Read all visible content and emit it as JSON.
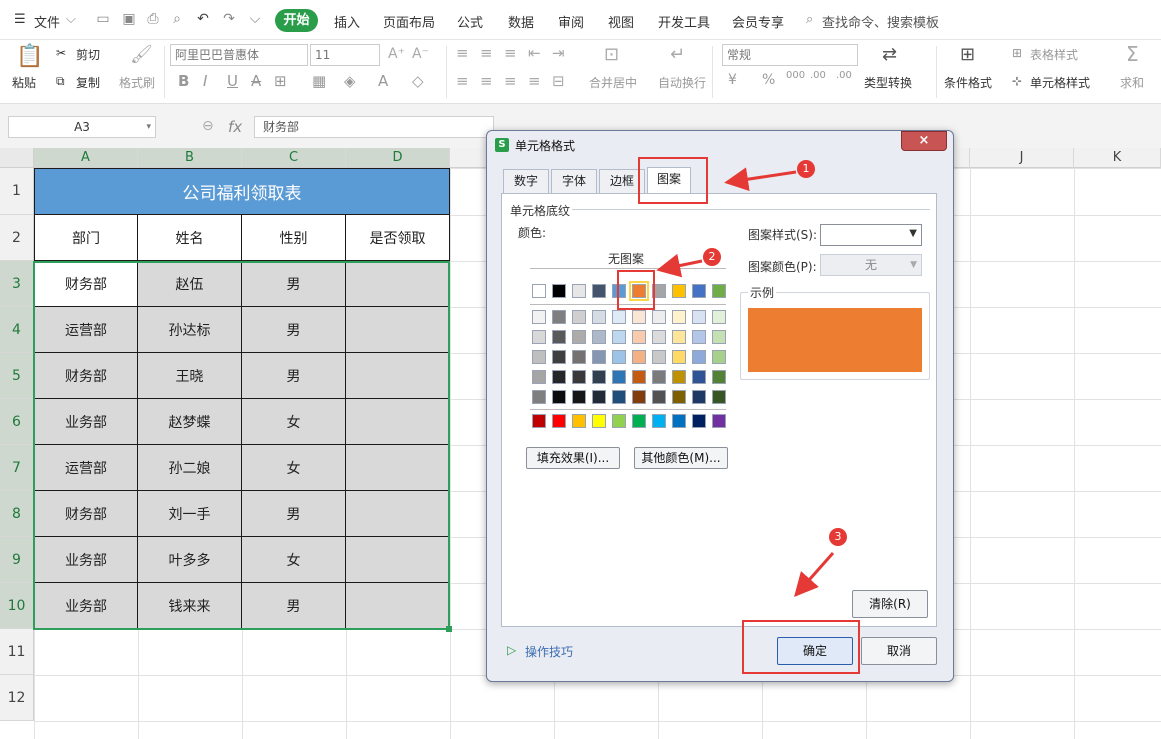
{
  "menubar": {
    "file": "文件",
    "tabs": [
      "开始",
      "插入",
      "页面布局",
      "公式",
      "数据",
      "审阅",
      "视图",
      "开发工具",
      "会员专享"
    ],
    "active_tab": "开始",
    "search": "查找命令、搜索模板"
  },
  "ribbon": {
    "paste": "粘贴",
    "cut": "剪切",
    "copy": "复制",
    "format_painter": "格式刷",
    "font_name": "阿里巴巴普惠体",
    "font_size": "11",
    "merge_center": "合并居中",
    "wrap_text": "自动换行",
    "number_format": "常规",
    "type_convert": "类型转换",
    "conditional_format": "条件格式",
    "table_style": "表格样式",
    "cell_style": "单元格样式",
    "sum": "求和",
    "bold": "B",
    "italic": "I",
    "underline": "U",
    "strike": "A",
    "font_color": "A",
    "currency": "¥",
    "percent": "%",
    "thousands": "000",
    "inc_decimal": ".00",
    "dec_decimal": ".00"
  },
  "formula_bar": {
    "cell_ref": "A3",
    "fx": "fx",
    "value": "财务部"
  },
  "sheet": {
    "columns": [
      "A",
      "B",
      "C",
      "D",
      "J",
      "K"
    ],
    "rows": [
      "1",
      "2",
      "3",
      "4",
      "5",
      "6",
      "7",
      "8",
      "9",
      "10",
      "11",
      "12"
    ],
    "title": "公司福利领取表",
    "headers": [
      "部门",
      "姓名",
      "性别",
      "是否领取"
    ],
    "data": [
      [
        "财务部",
        "赵伍",
        "男",
        ""
      ],
      [
        "运营部",
        "孙达标",
        "男",
        ""
      ],
      [
        "财务部",
        "王晓",
        "男",
        ""
      ],
      [
        "业务部",
        "赵梦蝶",
        "女",
        ""
      ],
      [
        "运营部",
        "孙二娘",
        "女",
        ""
      ],
      [
        "财务部",
        "刘一手",
        "男",
        ""
      ],
      [
        "业务部",
        "叶多多",
        "女",
        ""
      ],
      [
        "业务部",
        "钱来来",
        "男",
        ""
      ]
    ]
  },
  "dialog": {
    "title": "单元格格式",
    "close": "×",
    "tabs": [
      "数字",
      "字体",
      "边框",
      "图案"
    ],
    "active_tab": "图案",
    "section": "单元格底纹",
    "color_label": "颜色:",
    "no_pattern": "无图案",
    "pattern_style_label": "图案样式(S):",
    "pattern_color_label": "图案颜色(P):",
    "pattern_color_value": "无",
    "preview_label": "示例",
    "preview_color": "#ed7d31",
    "fill_effects": "填充效果(I)...",
    "more_colors": "其他颜色(M)...",
    "clear": "清除(R)",
    "ok": "确定",
    "cancel": "取消",
    "tips": "操作技巧"
  },
  "palette": {
    "row1": [
      "#ffffff",
      "#000000",
      "#e7e6e6",
      "#44546a",
      "#5b9bd5",
      "#ed7d31",
      "#a5a5a5",
      "#ffc000",
      "#4472c4",
      "#70ad47"
    ],
    "rows": [
      [
        "#f2f2f2",
        "#7f7f7f",
        "#d0cece",
        "#d6dce4",
        "#deebf6",
        "#fbe5d5",
        "#ededed",
        "#fff2cc",
        "#d9e2f3",
        "#e2efd9"
      ],
      [
        "#d8d8d8",
        "#595959",
        "#aeabab",
        "#adb9ca",
        "#bdd7ee",
        "#f7cbac",
        "#dbdbdb",
        "#fee599",
        "#b4c6e7",
        "#c5e0b3"
      ],
      [
        "#bfbfbf",
        "#3f3f3f",
        "#757171",
        "#8496b0",
        "#9dc3e6",
        "#f4b183",
        "#c9c9c9",
        "#ffd966",
        "#8eaadb",
        "#a8d08d"
      ],
      [
        "#a5a5a5",
        "#262626",
        "#3a3838",
        "#323f4f",
        "#2e75b5",
        "#c55a11",
        "#7b7b7b",
        "#bf9000",
        "#2f5496",
        "#538135"
      ],
      [
        "#7f7f7f",
        "#0c0c0c",
        "#171616",
        "#222a35",
        "#1e4e79",
        "#833c0b",
        "#525252",
        "#7f6000",
        "#1f3864",
        "#375623"
      ]
    ],
    "standard": [
      "#c00000",
      "#ff0000",
      "#ffc000",
      "#ffff00",
      "#92d050",
      "#00b050",
      "#00b0f0",
      "#0070c0",
      "#002060",
      "#7030a0"
    ],
    "selected_index": 5
  },
  "annotations": [
    "1",
    "2",
    "3"
  ],
  "colors": {
    "accent_green": "#2a9d4b",
    "title_bg": "#5b9bd5",
    "selection_border": "#2e9e5b",
    "annotation_red": "#e53935"
  }
}
